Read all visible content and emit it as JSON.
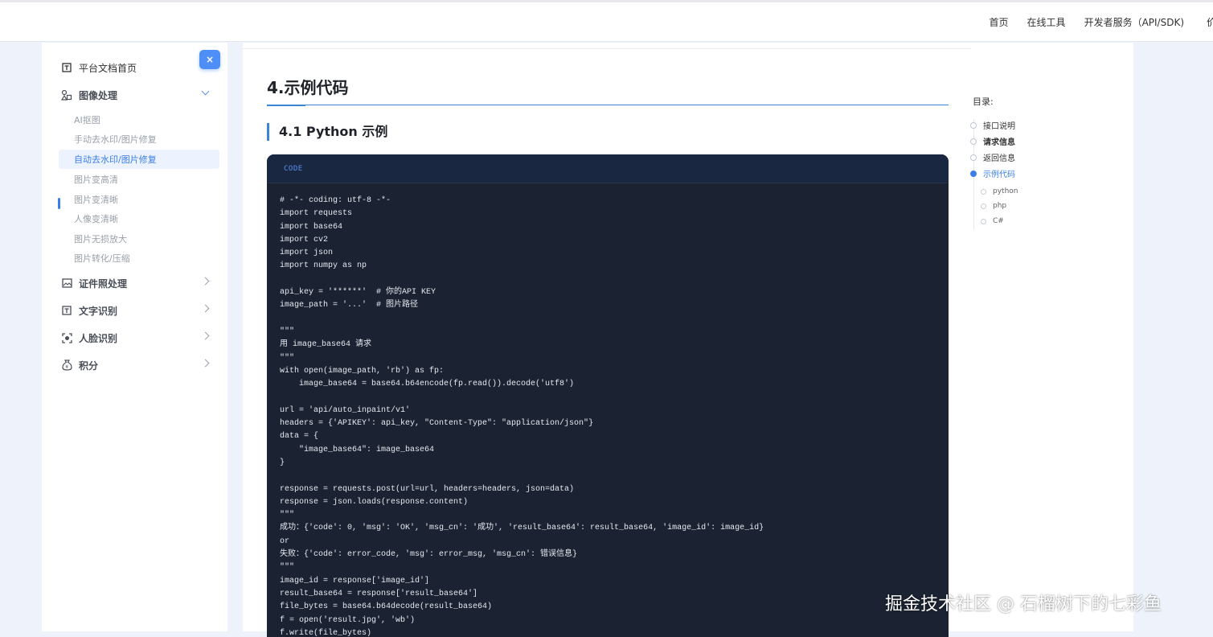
{
  "topnav": {
    "home": "首页",
    "online_tools": "在线工具",
    "dev_services": "开发者服务（API/SDK)",
    "cut_item": "价"
  },
  "sidebar": {
    "close_label": "×",
    "home": "平台文档首页",
    "image_processing": "图像处理",
    "sub_items": [
      "AI抠图",
      "手动去水印/图片修复",
      "自动去水印/图片修复",
      "图片变高清",
      "图片变清晰",
      "人像变清晰",
      "图片无损放大",
      "图片转化/压缩"
    ],
    "id_photo": "证件照处理",
    "ocr": "文字识别",
    "face": "人脸识别",
    "points": "积分"
  },
  "main": {
    "h1": "4.示例代码",
    "h2": "4.1 Python 示例",
    "code_label": "CODE",
    "code_lines": [
      "# -*- coding: utf-8 -*-",
      "import requests",
      "import base64",
      "import cv2",
      "import json",
      "import numpy as np",
      "",
      "api_key = '******'  # 你的API KEY",
      "image_path = '...'  # 图片路径",
      "",
      "\"\"\"",
      "用 image_base64 请求",
      "\"\"\"",
      "with open(image_path, 'rb') as fp:",
      "    image_base64 = base64.b64encode(fp.read()).decode('utf8')",
      "",
      "url = 'api/auto_inpaint/v1'",
      "headers = {'APIKEY': api_key, \"Content-Type\": \"application/json\"}",
      "data = {",
      "    \"image_base64\": image_base64",
      "}",
      "",
      "response = requests.post(url=url, headers=headers, json=data)",
      "response = json.loads(response.content)",
      "\"\"\"",
      "成功：{'code': 0, 'msg': 'OK', 'msg_cn': '成功', 'result_base64': result_base64, 'image_id': image_id}",
      "or",
      "失败：{'code': error_code, 'msg': error_msg, 'msg_cn': 错误信息}",
      "\"\"\"",
      "image_id = response['image_id']",
      "result_base64 = response['result_base64']",
      "file_bytes = base64.b64decode(result_base64)",
      "f = open('result.jpg', 'wb')",
      "f.write(file_bytes)"
    ]
  },
  "toc": {
    "title": "目录:",
    "items": [
      "接口说明",
      "请求信息",
      "返回信息",
      "示例代码"
    ],
    "subs": [
      "python",
      "php",
      "C#"
    ]
  },
  "watermark": "掘金技术社区 @ 石榴树下的七彩鱼"
}
